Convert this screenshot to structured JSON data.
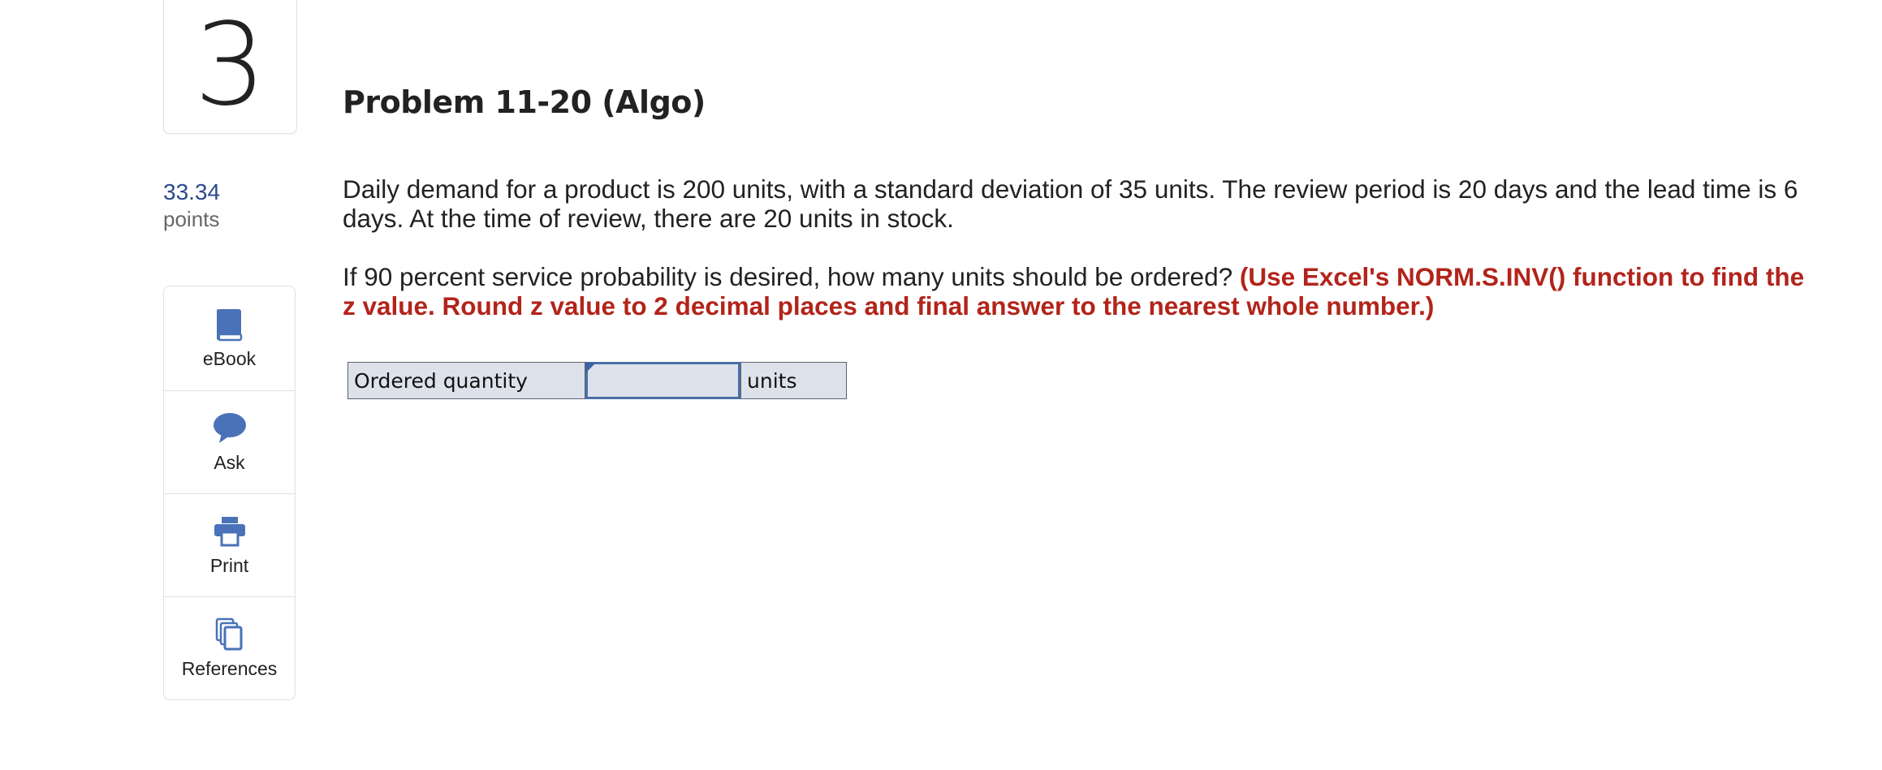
{
  "question": {
    "number": "3",
    "points_value": "33.34",
    "points_label": "points",
    "title": "Problem 11-20 (Algo)",
    "prompt": "Daily demand for a product is 200 units, with a standard deviation of 35 units. The review period is 20 days and the lead time is 6 days. At the time of review, there are 20 units in stock.",
    "question_text": "If 90 percent service probability is desired, how many units should be ordered?",
    "instruction": "(Use Excel's NORM.S.INV() function to find the z value. Round z value to 2 decimal places and final answer to the nearest whole number.)"
  },
  "tools": [
    {
      "label": "eBook",
      "icon": "book-icon"
    },
    {
      "label": "Ask",
      "icon": "speech-bubble-icon"
    },
    {
      "label": "Print",
      "icon": "printer-icon"
    },
    {
      "label": "References",
      "icon": "documents-icon"
    }
  ],
  "answer": {
    "label": "Ordered quantity",
    "value": "",
    "unit": "units"
  },
  "colors": {
    "instruction_red": "#b2241b",
    "points_blue": "#2a4a8a",
    "icon_blue": "#4a72b8",
    "cell_bg": "#dde2ea",
    "input_border": "#4a6fa8"
  }
}
